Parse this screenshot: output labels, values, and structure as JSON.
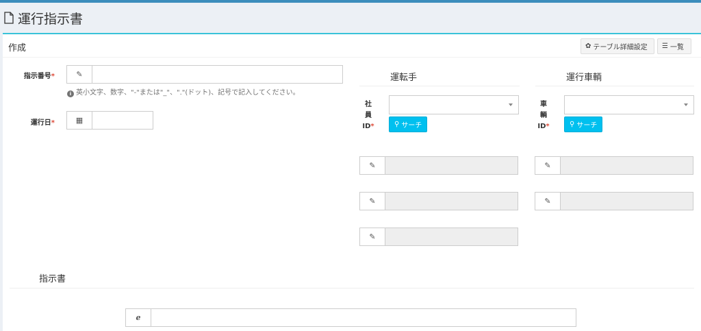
{
  "header": {
    "title": "運行指示書"
  },
  "box": {
    "title": "作成",
    "table_settings_label": "テーブル詳細設定",
    "list_label": "一覧"
  },
  "form": {
    "instruction_number": {
      "label": "指示番号",
      "required_mark": "*",
      "value": "",
      "help": "英小文字、数字、\"-\"または\"_\"、\".\"(ドット)、記号で記入してください。"
    },
    "operation_date": {
      "label": "運行日",
      "required_mark": "*",
      "value": ""
    }
  },
  "driver": {
    "title": "運転手",
    "id_label_chars": [
      "社",
      "員",
      "ID"
    ],
    "required_mark": "*",
    "search_label": "サーチ",
    "fields": [
      "",
      "",
      ""
    ]
  },
  "vehicle": {
    "title": "運行車輌",
    "id_label_chars": [
      "車",
      "輌",
      "ID"
    ],
    "required_mark": "*",
    "search_label": "サーチ",
    "fields": [
      "",
      ""
    ]
  },
  "instruction": {
    "title": "指示書",
    "value": ""
  },
  "icons": {
    "header": "document-icon",
    "table_settings": "gear-icon",
    "list": "list-icon",
    "edit": "pencil-icon",
    "calendar": "calendar-icon",
    "search": "magnifier-icon",
    "ie": "internet-explorer-icon"
  },
  "colors": {
    "accent": "#39c3d9",
    "topbar": "#3c8dbc",
    "search_button": "#00c0ef",
    "required": "#dd4b39"
  }
}
